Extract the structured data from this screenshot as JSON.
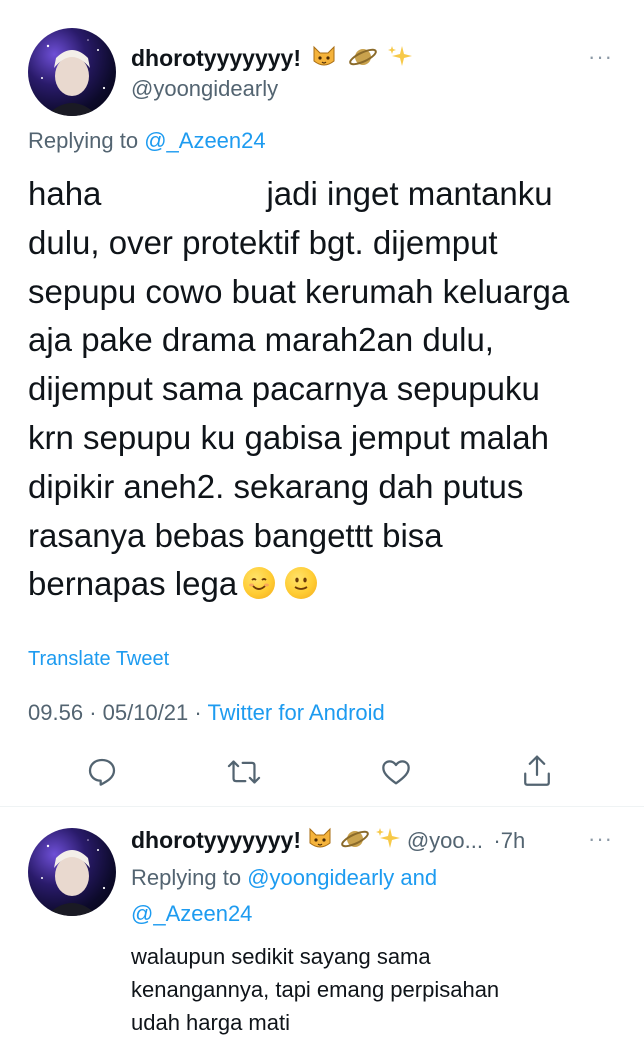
{
  "main_tweet": {
    "author_name": "dhorotyyyyyyy!",
    "name_emojis": [
      "cat-face-icon",
      "ringed-planet-icon",
      "sparkles-icon"
    ],
    "handle": "@yoongidearly",
    "more_label": "···",
    "replying_prefix": "Replying to",
    "replying_to": "@_Azeen24",
    "text_lines": [
      "haha                  jadi inget mantanku",
      "dulu, over protektif bgt. dijemput",
      "sepupu cowo buat kerumah keluarga",
      "aja pake drama marah2an dulu,",
      "dijemput sama pacarnya sepupuku",
      "krn sepupu ku gabisa jemput malah",
      "dipikir aneh2. sekarang dah putus",
      "rasanya bebas bangettt bisa",
      "bernapas lega"
    ],
    "end_emojis": [
      "smiling-face-with-smiling-eyes-icon",
      "slightly-smiling-face-icon"
    ],
    "translate_label": "Translate Tweet",
    "time": "09.56",
    "date": "05/10/21",
    "separator": "·",
    "source": "Twitter for Android"
  },
  "actions": [
    "reply-icon",
    "retweet-icon",
    "like-icon",
    "share-icon"
  ],
  "reply_tweet": {
    "author_name": "dhorotyyyyyyy!",
    "handle": "@yoo...",
    "time_ago": "·7h",
    "more_label": "···",
    "replying_prefix": "Replying to",
    "replying_to_1": "@yoongidearly",
    "replying_and": "and",
    "replying_to_2": "@_Azeen24",
    "text_lines": [
      "walaupun sedikit sayang sama",
      "kenangannya, tapi emang perpisahan",
      "udah harga mati"
    ]
  },
  "colors": {
    "link": "#1d9bf0",
    "secondary_text": "#536471",
    "primary_text": "#0f1419",
    "divider": "#eff3f4"
  }
}
